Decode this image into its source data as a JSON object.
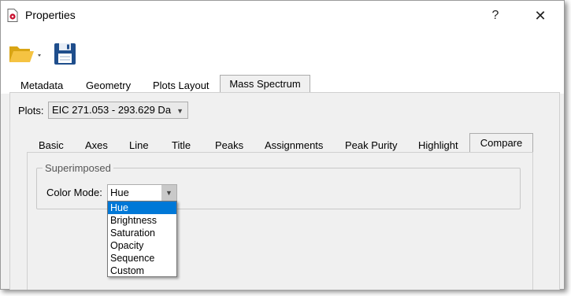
{
  "window": {
    "title": "Properties",
    "help_label": "?",
    "close_label": "✕"
  },
  "toolbar": {
    "open_icon": "open-folder-icon",
    "save_icon": "floppy-save-icon"
  },
  "main_tabs": [
    {
      "label": "Metadata",
      "active": false
    },
    {
      "label": "Geometry",
      "active": false
    },
    {
      "label": "Plots Layout",
      "active": false
    },
    {
      "label": "Mass Spectrum",
      "active": true
    }
  ],
  "plots": {
    "label": "Plots:",
    "selected": "EIC 271.053 - 293.629 Da"
  },
  "sub_tabs": [
    {
      "label": "Basic",
      "active": false
    },
    {
      "label": "Axes",
      "active": false
    },
    {
      "label": "Line",
      "active": false
    },
    {
      "label": "Title",
      "active": false
    },
    {
      "label": "Peaks",
      "active": false
    },
    {
      "label": "Assignments",
      "active": false
    },
    {
      "label": "Peak Purity",
      "active": false
    },
    {
      "label": "Highlight",
      "active": false
    },
    {
      "label": "Compare",
      "active": true
    }
  ],
  "superimposed": {
    "title": "Superimposed",
    "color_mode_label": "Color Mode:",
    "color_mode_value": "Hue",
    "options": [
      "Hue",
      "Brightness",
      "Saturation",
      "Opacity",
      "Sequence",
      "Custom"
    ],
    "selected_option": "Hue"
  },
  "colors": {
    "selection": "#0078d7",
    "folder": "#f5c342",
    "floppy": "#1f4e8c",
    "app_icon": "#c8102e"
  }
}
